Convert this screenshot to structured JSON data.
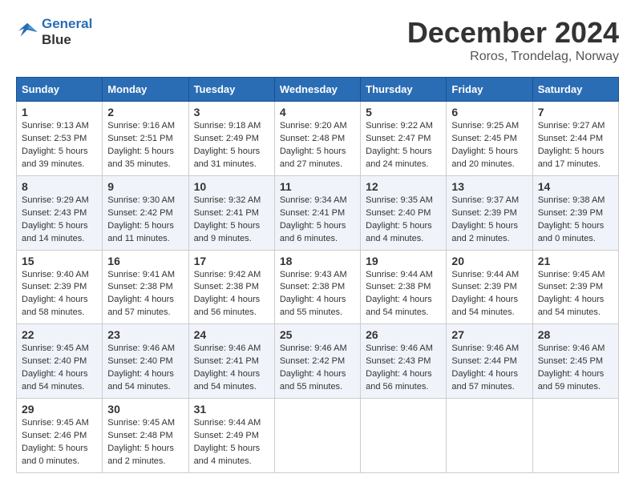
{
  "header": {
    "logo_line1": "General",
    "logo_line2": "Blue",
    "month_title": "December 2024",
    "location": "Roros, Trondelag, Norway"
  },
  "weekdays": [
    "Sunday",
    "Monday",
    "Tuesday",
    "Wednesday",
    "Thursday",
    "Friday",
    "Saturday"
  ],
  "weeks": [
    [
      {
        "day": "1",
        "info": "Sunrise: 9:13 AM\nSunset: 2:53 PM\nDaylight: 5 hours\nand 39 minutes."
      },
      {
        "day": "2",
        "info": "Sunrise: 9:16 AM\nSunset: 2:51 PM\nDaylight: 5 hours\nand 35 minutes."
      },
      {
        "day": "3",
        "info": "Sunrise: 9:18 AM\nSunset: 2:49 PM\nDaylight: 5 hours\nand 31 minutes."
      },
      {
        "day": "4",
        "info": "Sunrise: 9:20 AM\nSunset: 2:48 PM\nDaylight: 5 hours\nand 27 minutes."
      },
      {
        "day": "5",
        "info": "Sunrise: 9:22 AM\nSunset: 2:47 PM\nDaylight: 5 hours\nand 24 minutes."
      },
      {
        "day": "6",
        "info": "Sunrise: 9:25 AM\nSunset: 2:45 PM\nDaylight: 5 hours\nand 20 minutes."
      },
      {
        "day": "7",
        "info": "Sunrise: 9:27 AM\nSunset: 2:44 PM\nDaylight: 5 hours\nand 17 minutes."
      }
    ],
    [
      {
        "day": "8",
        "info": "Sunrise: 9:29 AM\nSunset: 2:43 PM\nDaylight: 5 hours\nand 14 minutes."
      },
      {
        "day": "9",
        "info": "Sunrise: 9:30 AM\nSunset: 2:42 PM\nDaylight: 5 hours\nand 11 minutes."
      },
      {
        "day": "10",
        "info": "Sunrise: 9:32 AM\nSunset: 2:41 PM\nDaylight: 5 hours\nand 9 minutes."
      },
      {
        "day": "11",
        "info": "Sunrise: 9:34 AM\nSunset: 2:41 PM\nDaylight: 5 hours\nand 6 minutes."
      },
      {
        "day": "12",
        "info": "Sunrise: 9:35 AM\nSunset: 2:40 PM\nDaylight: 5 hours\nand 4 minutes."
      },
      {
        "day": "13",
        "info": "Sunrise: 9:37 AM\nSunset: 2:39 PM\nDaylight: 5 hours\nand 2 minutes."
      },
      {
        "day": "14",
        "info": "Sunrise: 9:38 AM\nSunset: 2:39 PM\nDaylight: 5 hours\nand 0 minutes."
      }
    ],
    [
      {
        "day": "15",
        "info": "Sunrise: 9:40 AM\nSunset: 2:39 PM\nDaylight: 4 hours\nand 58 minutes."
      },
      {
        "day": "16",
        "info": "Sunrise: 9:41 AM\nSunset: 2:38 PM\nDaylight: 4 hours\nand 57 minutes."
      },
      {
        "day": "17",
        "info": "Sunrise: 9:42 AM\nSunset: 2:38 PM\nDaylight: 4 hours\nand 56 minutes."
      },
      {
        "day": "18",
        "info": "Sunrise: 9:43 AM\nSunset: 2:38 PM\nDaylight: 4 hours\nand 55 minutes."
      },
      {
        "day": "19",
        "info": "Sunrise: 9:44 AM\nSunset: 2:38 PM\nDaylight: 4 hours\nand 54 minutes."
      },
      {
        "day": "20",
        "info": "Sunrise: 9:44 AM\nSunset: 2:39 PM\nDaylight: 4 hours\nand 54 minutes."
      },
      {
        "day": "21",
        "info": "Sunrise: 9:45 AM\nSunset: 2:39 PM\nDaylight: 4 hours\nand 54 minutes."
      }
    ],
    [
      {
        "day": "22",
        "info": "Sunrise: 9:45 AM\nSunset: 2:40 PM\nDaylight: 4 hours\nand 54 minutes."
      },
      {
        "day": "23",
        "info": "Sunrise: 9:46 AM\nSunset: 2:40 PM\nDaylight: 4 hours\nand 54 minutes."
      },
      {
        "day": "24",
        "info": "Sunrise: 9:46 AM\nSunset: 2:41 PM\nDaylight: 4 hours\nand 54 minutes."
      },
      {
        "day": "25",
        "info": "Sunrise: 9:46 AM\nSunset: 2:42 PM\nDaylight: 4 hours\nand 55 minutes."
      },
      {
        "day": "26",
        "info": "Sunrise: 9:46 AM\nSunset: 2:43 PM\nDaylight: 4 hours\nand 56 minutes."
      },
      {
        "day": "27",
        "info": "Sunrise: 9:46 AM\nSunset: 2:44 PM\nDaylight: 4 hours\nand 57 minutes."
      },
      {
        "day": "28",
        "info": "Sunrise: 9:46 AM\nSunset: 2:45 PM\nDaylight: 4 hours\nand 59 minutes."
      }
    ],
    [
      {
        "day": "29",
        "info": "Sunrise: 9:45 AM\nSunset: 2:46 PM\nDaylight: 5 hours\nand 0 minutes."
      },
      {
        "day": "30",
        "info": "Sunrise: 9:45 AM\nSunset: 2:48 PM\nDaylight: 5 hours\nand 2 minutes."
      },
      {
        "day": "31",
        "info": "Sunrise: 9:44 AM\nSunset: 2:49 PM\nDaylight: 5 hours\nand 4 minutes."
      },
      null,
      null,
      null,
      null
    ]
  ]
}
